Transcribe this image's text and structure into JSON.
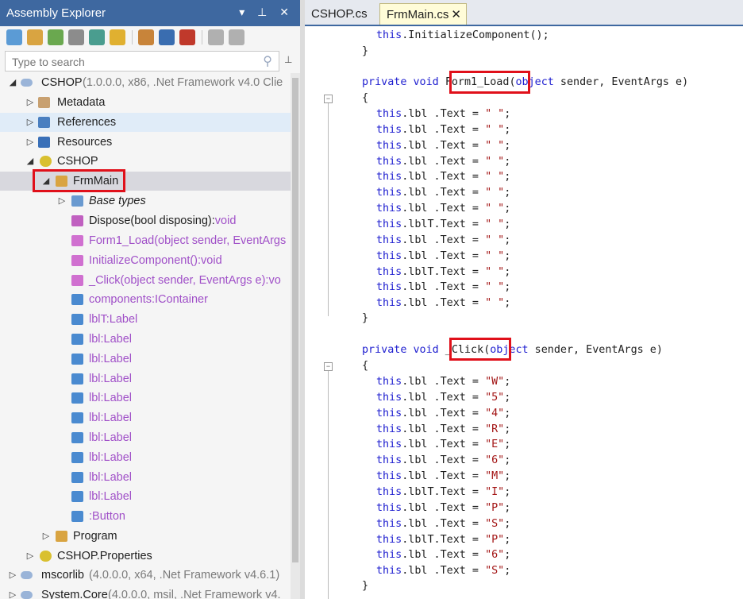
{
  "panel": {
    "title": "Assembly Explorer",
    "header_buttons": "▾ ⊥ ✕"
  },
  "search": {
    "placeholder": "Type to search"
  },
  "tree": {
    "cshop_name": "CSHOP",
    "cshop_meta": " (1.0.0.0, x86, .Net Framework v4.0 Clie",
    "metadata": "Metadata",
    "references": "References",
    "resources": "Resources",
    "namespace": "CSHOP",
    "frmmain": "FrmMain",
    "base_types": "Base types",
    "dispose_name": "Dispose(bool disposing):",
    "dispose_type": "void",
    "members": [
      "Form1_Load(object sender, EventArgs",
      "InitializeComponent():void",
      "_Click(object sender, EventArgs e):vo",
      "components:IContainer",
      "lblT:Label",
      "lbl:Label",
      "lbl:Label",
      "lbl:Label",
      "lbl:Label",
      "lbl:Label",
      "lbl:Label",
      "lbl:Label",
      "lbl:Label",
      "lbl:Label",
      ":Button"
    ],
    "program": "Program",
    "properties": "CSHOP.Properties",
    "mscorlib_name": "mscorlib",
    "mscorlib_meta": " (4.0.0.0, x64, .Net Framework v4.6.1)",
    "syscore_name": "System.Core",
    "syscore_meta": " (4.0.0.0, msil, .Net Framework v4."
  },
  "tabs": [
    {
      "label": "CSHOP.cs"
    },
    {
      "label": "FrmMain.cs",
      "close": "✕"
    }
  ],
  "code": {
    "l0": "this",
    "l0b": ".InitializeComponent();",
    "close": "}",
    "open": "{",
    "private": "private",
    "void": "void",
    "load_name": "Form1_Load",
    "load_paren": "(",
    "object": "object",
    "sig_rest": " sender, EventArgs e)",
    "click_name": " _Click",
    "this": "this",
    "load_body": [
      {
        "target": ".lbl .Text = ",
        "value": "\" \""
      },
      {
        "target": ".lbl .Text = ",
        "value": "\" \""
      },
      {
        "target": ".lbl .Text = ",
        "value": "\" \""
      },
      {
        "target": ".lbl .Text = ",
        "value": "\" \""
      },
      {
        "target": ".lbl .Text = ",
        "value": "\" \""
      },
      {
        "target": ".lbl .Text = ",
        "value": "\" \""
      },
      {
        "target": ".lbl .Text = ",
        "value": "\" \""
      },
      {
        "target": ".lblT.Text = ",
        "value": "\" \""
      },
      {
        "target": ".lbl .Text = ",
        "value": "\" \""
      },
      {
        "target": ".lbl .Text = ",
        "value": "\" \""
      },
      {
        "target": ".lblT.Text = ",
        "value": "\" \""
      },
      {
        "target": ".lbl .Text = ",
        "value": "\" \""
      },
      {
        "target": ".lbl .Text = ",
        "value": "\" \""
      }
    ],
    "click_body": [
      {
        "target": ".lbl .Text = ",
        "value": "\"W\""
      },
      {
        "target": ".lbl .Text = ",
        "value": "\"5\""
      },
      {
        "target": ".lbl .Text = ",
        "value": "\"4\""
      },
      {
        "target": ".lbl .Text = ",
        "value": "\"R\""
      },
      {
        "target": ".lbl .Text = ",
        "value": "\"E\""
      },
      {
        "target": ".lbl .Text = ",
        "value": "\"6\""
      },
      {
        "target": ".lbl .Text = ",
        "value": "\"M\""
      },
      {
        "target": ".lblT.Text = ",
        "value": "\"I\""
      },
      {
        "target": ".lbl .Text = ",
        "value": "\"P\""
      },
      {
        "target": ".lbl .Text = ",
        "value": "\"S\""
      },
      {
        "target": ".lblT.Text = ",
        "value": "\"P\""
      },
      {
        "target": ".lbl .Text = ",
        "value": "\"6\""
      },
      {
        "target": ".lbl .Text = ",
        "value": "\"S\""
      }
    ],
    "semicolon": ";"
  },
  "colors": {
    "keyword": "#2020d0",
    "string": "#a31515",
    "member": "#a050c8",
    "title_bar": "#3e68a0",
    "highlight_box": "#e0101a"
  }
}
